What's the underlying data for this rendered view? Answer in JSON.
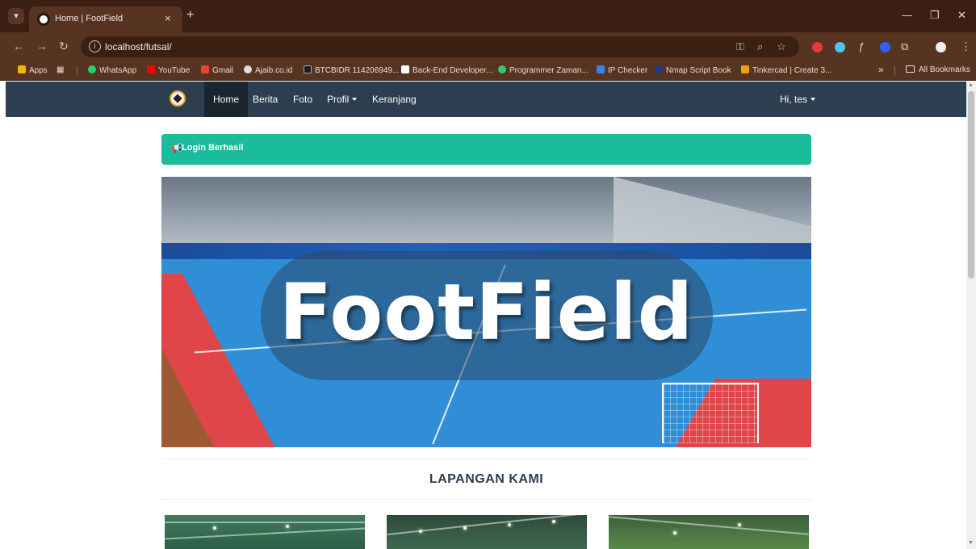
{
  "browser": {
    "tab_title": "Home | FootField",
    "new_tab_symbol": "+",
    "tab_close_symbol": "×",
    "url": "localhost/futsal/",
    "bookmarks": [
      {
        "label": "Apps",
        "color": "#f4b400"
      },
      {
        "label": "WhatsApp",
        "color": "#25d366"
      },
      {
        "label": "YouTube",
        "color": "#ff0000"
      },
      {
        "label": "Gmail",
        "color": "#ea4335"
      },
      {
        "label": "Ajaib.co.id",
        "color": "#dddddd"
      },
      {
        "label": "BTCBIDR 114206949...",
        "color": "#1e1e1e"
      },
      {
        "label": "Back-End Developer...",
        "color": "#ffffff"
      },
      {
        "label": "Programmer Zaman...",
        "color": "#2ecc71"
      },
      {
        "label": "IP Checker",
        "color": "#3b82f6"
      },
      {
        "label": "Nmap Script Book",
        "color": "#1e3a8a"
      },
      {
        "label": "Tinkercad | Create 3...",
        "color": "#f59e0b"
      }
    ],
    "all_bookmarks": "All Bookmarks",
    "more_symbol": "»"
  },
  "navbar": {
    "items": [
      {
        "label": "Home",
        "active": true
      },
      {
        "label": "Berita"
      },
      {
        "label": "Foto"
      },
      {
        "label": "Profil"
      },
      {
        "label": "Keranjang"
      }
    ],
    "user_menu": "Hi, tes"
  },
  "alert": {
    "text": "Login Berhasil",
    "color": "#1abc9c"
  },
  "hero": {
    "title": "FootField"
  },
  "section": {
    "title": "LAPANGAN KAMI"
  },
  "colors": {
    "navbar": "#2c3e50",
    "navbar_active": "#1a252f",
    "chrome_frame": "#3b1f12",
    "chrome_toolbar": "#573322"
  }
}
